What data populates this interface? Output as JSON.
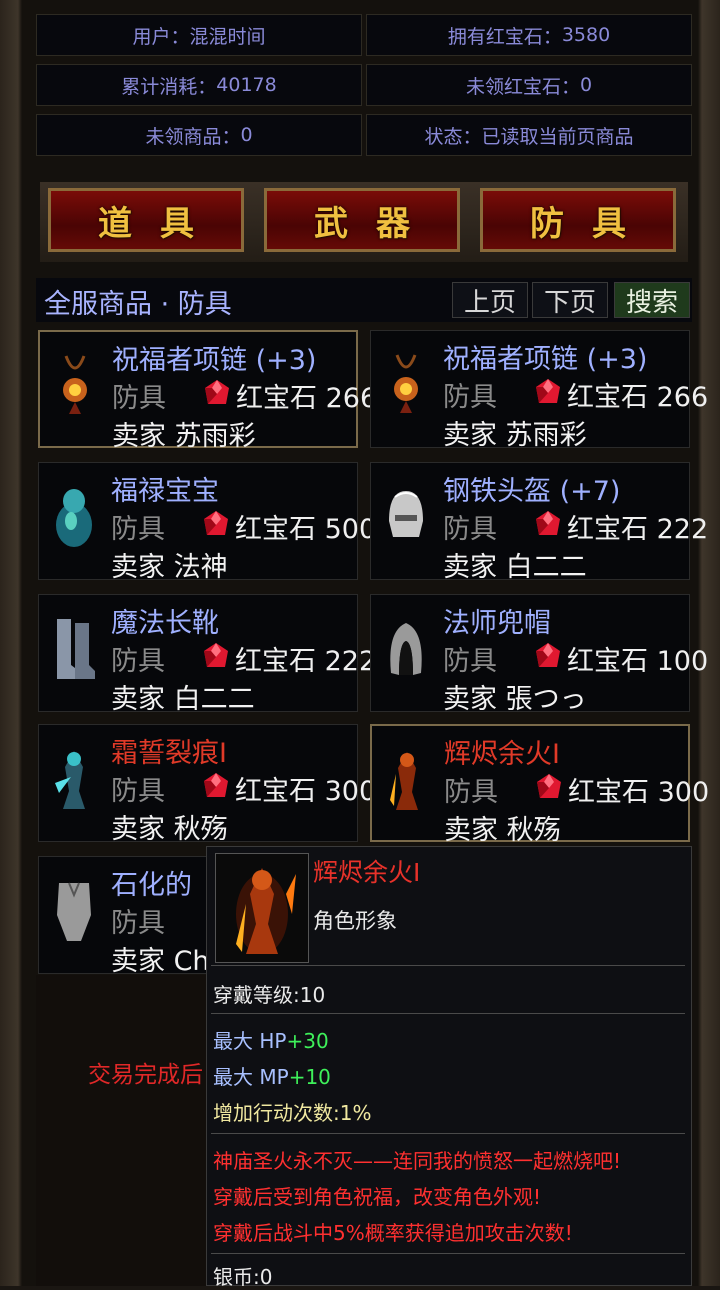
{
  "stats": {
    "user_label": "用户：",
    "user_value": "混混时间",
    "ruby_label": "拥有红宝石：",
    "ruby_value": "3580",
    "spent_label": "累计消耗：",
    "spent_value": "40178",
    "unclaimed_ruby_label": "未领红宝石：",
    "unclaimed_ruby_value": "0",
    "unclaimed_goods_label": "未领商品：",
    "unclaimed_goods_value": "0",
    "status_label": "状态：",
    "status_value": "已读取当前页商品"
  },
  "tabs": [
    "道具",
    "武器",
    "防具"
  ],
  "list_header": {
    "title": "全服商品 · 防具",
    "prev": "上页",
    "next": "下页",
    "search": "搜索"
  },
  "items": [
    {
      "name": "祝福者项链 (+3)",
      "category": "防具",
      "price": "红宝石 266",
      "seller": "卖家 苏雨彩",
      "icon": "necklace-icon"
    },
    {
      "name": "祝福者项链 (+3)",
      "category": "防具",
      "price": "红宝石 266",
      "seller": "卖家 苏雨彩",
      "icon": "necklace-icon"
    },
    {
      "name": "福禄宝宝",
      "category": "防具",
      "price": "红宝石 500",
      "seller": "卖家 法神",
      "icon": "gourd-icon"
    },
    {
      "name": "钢铁头盔 (+7)",
      "category": "防具",
      "price": "红宝石 222",
      "seller": "卖家 白二二",
      "icon": "helmet-icon"
    },
    {
      "name": "魔法长靴",
      "category": "防具",
      "price": "红宝石 222",
      "seller": "卖家 白二二",
      "icon": "boots-icon"
    },
    {
      "name": "法师兜帽",
      "category": "防具",
      "price": "红宝石 100",
      "seller": "卖家 張つっ",
      "icon": "hood-icon"
    },
    {
      "name": "霜誓裂痕I",
      "category": "防具",
      "price": "红宝石 300",
      "seller": "卖家 秋殇",
      "icon": "frost-avatar-icon"
    },
    {
      "name": "辉烬余火I",
      "category": "防具",
      "price": "红宝石 300",
      "seller": "卖家 秋殇",
      "icon": "flame-avatar-icon"
    },
    {
      "name": "石化的",
      "category": "防具",
      "price": "",
      "seller": "卖家 Ch",
      "icon": "stone-armor-icon"
    }
  ],
  "trade_note": "交易完成后",
  "tooltip": {
    "name": "辉烬余火I",
    "type": "角色形象",
    "level": "穿戴等级:10",
    "hp_label": "最大 HP",
    "hp_value": "+30",
    "mp_label": "最大 MP",
    "mp_value": "+10",
    "action": "增加行动次数:1%",
    "lore1": "神庙圣火永不灭——连同我的愤怒一起燃烧吧!",
    "lore2": "穿戴后受到角色祝福，改变角色外观!",
    "lore3": "穿戴后战斗中5%概率获得追加攻击次数!",
    "silver": "银币:0"
  },
  "colors": {
    "accent_gold": "#f0c040",
    "name_blue": "#9fb0ff",
    "name_red": "#e03a28",
    "stat_green": "#3ef05a"
  }
}
